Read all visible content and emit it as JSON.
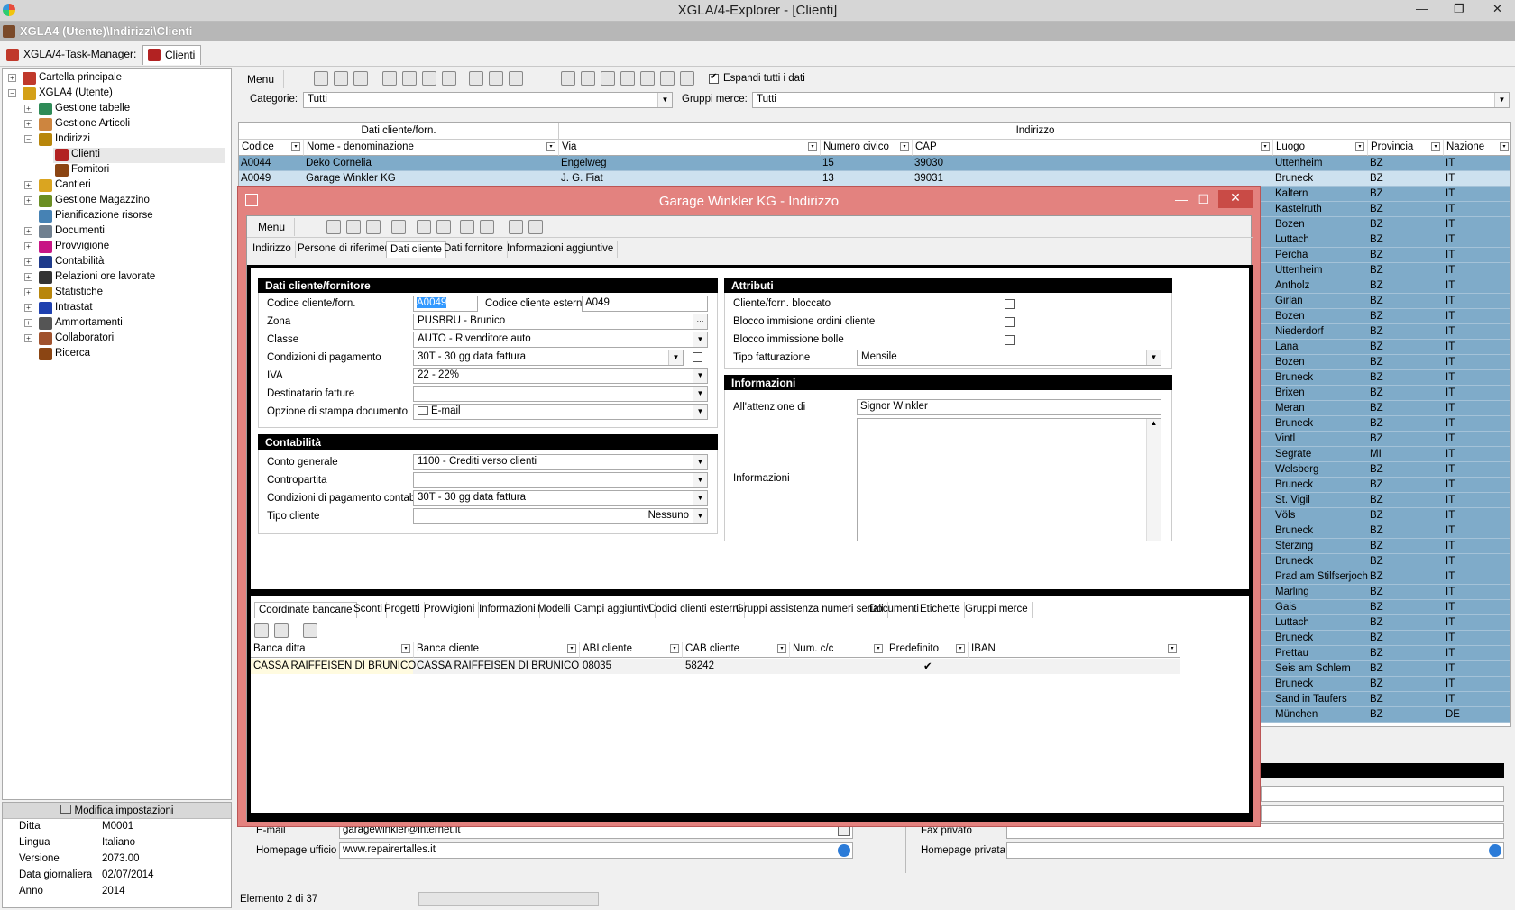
{
  "window": {
    "title": "XGLA/4-Explorer - [Clienti]",
    "path": "XGLA4 (Utente)\\Indirizzi\\Clienti"
  },
  "taskbar": {
    "items": [
      {
        "label": "XGLA/4-Task-Manager:"
      },
      {
        "label": "Clienti"
      }
    ]
  },
  "tree": {
    "items": [
      {
        "label": "Cartella principale",
        "color": "#c0392b"
      },
      {
        "label": "XGLA4 (Utente)",
        "color": "#d4a017"
      },
      {
        "label": "Gestione tabelle",
        "color": "#2e8b57"
      },
      {
        "label": "Gestione Articoli",
        "color": "#cd853f"
      },
      {
        "label": "Indirizzi",
        "color": "#b8860b"
      },
      {
        "label": "Clienti",
        "color": "#b22222"
      },
      {
        "label": "Fornitori",
        "color": "#8b4513"
      },
      {
        "label": "Cantieri",
        "color": "#daa520"
      },
      {
        "label": "Gestione Magazzino",
        "color": "#6b8e23"
      },
      {
        "label": "Pianificazione risorse",
        "color": "#4682b4"
      },
      {
        "label": "Documenti",
        "color": "#708090"
      },
      {
        "label": "Provvigione",
        "color": "#c71585"
      },
      {
        "label": "Contabilità",
        "color": "#1e3a8a"
      },
      {
        "label": "Relazioni ore lavorate",
        "color": "#333333"
      },
      {
        "label": "Statistiche",
        "color": "#b8860b"
      },
      {
        "label": "Intrastat",
        "color": "#1e40af"
      },
      {
        "label": "Ammortamenti",
        "color": "#555555"
      },
      {
        "label": "Collaboratori",
        "color": "#a0522d"
      },
      {
        "label": "Ricerca",
        "color": "#8b4513"
      }
    ]
  },
  "props": {
    "header": "Modifica impostazioni",
    "rows": [
      {
        "k": "Ditta",
        "v": "M0001"
      },
      {
        "k": "Lingua",
        "v": "Italiano"
      },
      {
        "k": "Versione",
        "v": "2073.00"
      },
      {
        "k": "Data giornaliera",
        "v": "02/07/2014"
      },
      {
        "k": "Anno",
        "v": "2014"
      }
    ]
  },
  "toolbar": {
    "menu": "Menu",
    "expand_all": "Espandi tutti i dati"
  },
  "filters": {
    "categorie_label": "Categorie:",
    "categorie_value": "Tutti",
    "gruppi_label": "Gruppi merce:",
    "gruppi_value": "Tutti"
  },
  "grid": {
    "group_headers": [
      "Dati cliente/forn.",
      "Indirizzo"
    ],
    "columns": [
      "Codice",
      "Nome - denominazione",
      "Via",
      "Numero civico",
      "CAP",
      "Luogo",
      "Provincia",
      "Nazione"
    ],
    "rows": [
      {
        "codice": "A0044",
        "nome": "Deko Cornelia",
        "via": "Engelweg",
        "civico": "15",
        "cap": "39030",
        "luogo": "Uttenheim",
        "prov": "BZ",
        "naz": "IT"
      },
      {
        "codice": "A0049",
        "nome": "Garage Winkler KG",
        "via": "J. G. Fiat",
        "civico": "13",
        "cap": "39031",
        "luogo": "Bruneck",
        "prov": "BZ",
        "naz": "IT"
      }
    ],
    "side_rows": [
      {
        "luogo": "Kaltern",
        "prov": "BZ",
        "naz": "IT"
      },
      {
        "luogo": "Kastelruth",
        "prov": "BZ",
        "naz": "IT"
      },
      {
        "luogo": "Bozen",
        "prov": "BZ",
        "naz": "IT"
      },
      {
        "luogo": "Luttach",
        "prov": "BZ",
        "naz": "IT"
      },
      {
        "luogo": "Percha",
        "prov": "BZ",
        "naz": "IT"
      },
      {
        "luogo": "Uttenheim",
        "prov": "BZ",
        "naz": "IT"
      },
      {
        "luogo": "Antholz",
        "prov": "BZ",
        "naz": "IT"
      },
      {
        "luogo": "Girlan",
        "prov": "BZ",
        "naz": "IT"
      },
      {
        "luogo": "Bozen",
        "prov": "BZ",
        "naz": "IT"
      },
      {
        "luogo": "Niederdorf",
        "prov": "BZ",
        "naz": "IT"
      },
      {
        "luogo": "Lana",
        "prov": "BZ",
        "naz": "IT"
      },
      {
        "luogo": "Bozen",
        "prov": "BZ",
        "naz": "IT"
      },
      {
        "luogo": "Bruneck",
        "prov": "BZ",
        "naz": "IT"
      },
      {
        "luogo": "Brixen",
        "prov": "BZ",
        "naz": "IT"
      },
      {
        "luogo": "Meran",
        "prov": "BZ",
        "naz": "IT"
      },
      {
        "luogo": "Bruneck",
        "prov": "BZ",
        "naz": "IT"
      },
      {
        "luogo": "Vintl",
        "prov": "BZ",
        "naz": "IT"
      },
      {
        "luogo": "Segrate",
        "prov": "MI",
        "naz": "IT"
      },
      {
        "luogo": "Welsberg",
        "prov": "BZ",
        "naz": "IT"
      },
      {
        "luogo": "Bruneck",
        "prov": "BZ",
        "naz": "IT"
      },
      {
        "luogo": "St. Vigil",
        "prov": "BZ",
        "naz": "IT"
      },
      {
        "luogo": "Völs",
        "prov": "BZ",
        "naz": "IT"
      },
      {
        "luogo": "Bruneck",
        "prov": "BZ",
        "naz": "IT"
      },
      {
        "luogo": "Sterzing",
        "prov": "BZ",
        "naz": "IT"
      },
      {
        "luogo": "Bruneck",
        "prov": "BZ",
        "naz": "IT"
      },
      {
        "luogo": "Prad am Stilfserjoch",
        "prov": "BZ",
        "naz": "IT"
      },
      {
        "luogo": "Marling",
        "prov": "BZ",
        "naz": "IT"
      },
      {
        "luogo": "Gais",
        "prov": "BZ",
        "naz": "IT"
      },
      {
        "luogo": "Luttach",
        "prov": "BZ",
        "naz": "IT"
      },
      {
        "luogo": "Bruneck",
        "prov": "BZ",
        "naz": "IT"
      },
      {
        "luogo": "Prettau",
        "prov": "BZ",
        "naz": "IT"
      },
      {
        "luogo": "Seis am Schlern",
        "prov": "BZ",
        "naz": "IT"
      },
      {
        "luogo": "Bruneck",
        "prov": "BZ",
        "naz": "IT"
      },
      {
        "luogo": "Sand in Taufers",
        "prov": "BZ",
        "naz": "IT"
      },
      {
        "luogo": "München",
        "prov": "BZ",
        "naz": "DE"
      }
    ]
  },
  "lower": {
    "email_label": "E-mail",
    "email_value": "garagewinkler@internet.it",
    "homepage_label": "Homepage ufficio",
    "homepage_value": "www.repairertalles.it",
    "fax_label": "Fax privato",
    "homepage_priv_label": "Homepage privata"
  },
  "status": {
    "text": "Elemento 2 di 37"
  },
  "dialog": {
    "title": "Garage Winkler KG - Indirizzo",
    "menu": "Menu",
    "tabs": [
      "Indirizzo",
      "Persone di riferimento",
      "Dati cliente",
      "Dati fornitore",
      "Informazioni aggiuntive"
    ],
    "sect_dati": "Dati cliente/fornitore",
    "codice_label": "Codice cliente/forn.",
    "codice_value": "A0049",
    "codice_est_label": "Codice cliente esterno",
    "codice_est_value": "A049",
    "zona_label": "Zona",
    "zona_value": "PUSBRU - Brunico",
    "classe_label": "Classe",
    "classe_value": "AUTO - Rivenditore auto",
    "cond_label": "Condizioni di pagamento",
    "cond_value": "30T - 30 gg data fattura",
    "iva_label": "IVA",
    "iva_value": "22 - 22%",
    "dest_label": "Destinatario fatture",
    "stampa_label": "Opzione di stampa documento",
    "stampa_value": "E-mail",
    "sect_contab": "Contabilità",
    "conto_label": "Conto generale",
    "conto_value": "1100 - Crediti verso clienti",
    "contro_label": "Contropartita",
    "condc_label": "Condizioni di pagamento contabilità",
    "condc_value": "30T - 30 gg data fattura",
    "tipo_label": "Tipo cliente",
    "tipo_value": "Nessuno",
    "sect_attr": "Attributi",
    "attr_bloccato": "Cliente/forn. bloccato",
    "attr_ordini": "Blocco immisione ordini cliente",
    "attr_bolle": "Blocco immissione bolle",
    "tipofatt_label": "Tipo fatturazione",
    "tipofatt_value": "Mensile",
    "sect_info": "Informazioni",
    "att_label": "All'attenzione di",
    "att_value": "Signor Winkler",
    "info_label": "Informazioni",
    "subtabs": [
      "Coordinate bancarie",
      "Sconti",
      "Progetti",
      "Provvigioni",
      "Informazioni",
      "Modelli",
      "Campi aggiuntivi",
      "Codici clienti esterni",
      "Gruppi assistenza numeri seriali",
      "Documenti",
      "Etichette",
      "Gruppi merce"
    ],
    "bank_columns": [
      "Banca ditta",
      "Banca cliente",
      "ABI cliente",
      "CAB cliente",
      "Num. c/c",
      "Predefinito",
      "IBAN"
    ],
    "bank_row": {
      "banca_ditta": "CASSA RAIFFEISEN DI BRUNICO",
      "banca_cliente": "CASSA RAIFFEISEN DI BRUNICO",
      "abi": "08035",
      "cab": "58242",
      "predefinito": "✔"
    }
  }
}
